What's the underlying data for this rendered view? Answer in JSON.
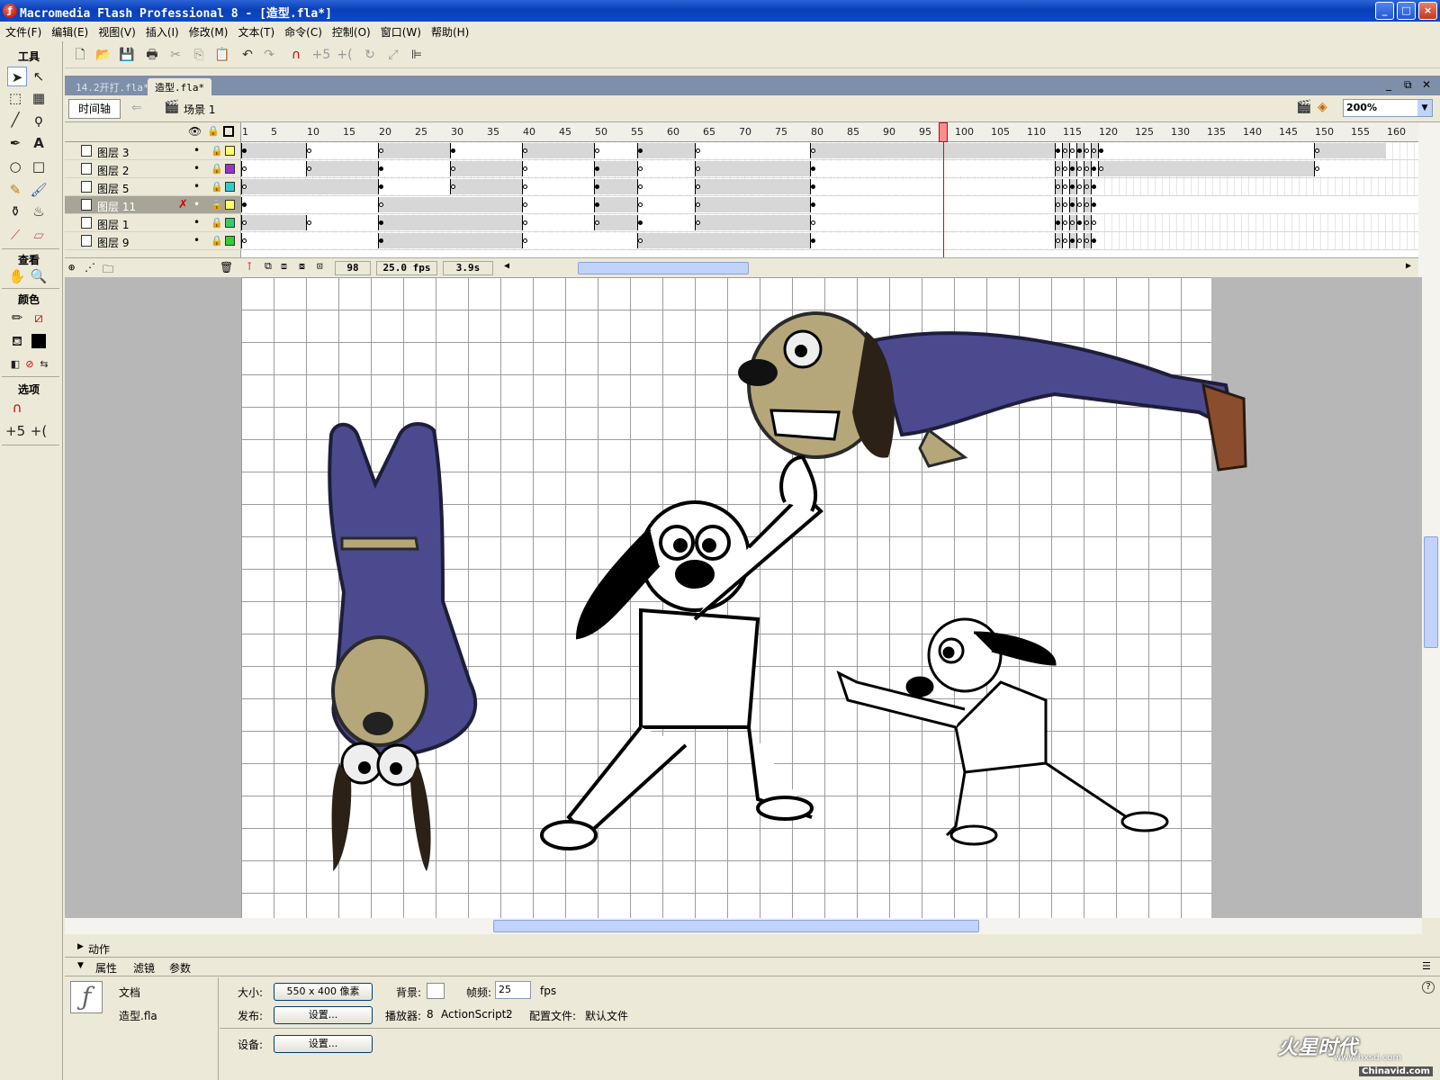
{
  "window": {
    "title": "Macromedia Flash Professional 8 - [造型.fla*]",
    "controls": [
      "_",
      "□",
      "×"
    ]
  },
  "menu": [
    "文件(F)",
    "编辑(E)",
    "视图(V)",
    "插入(I)",
    "修改(M)",
    "文本(T)",
    "命令(C)",
    "控制(O)",
    "窗口(W)",
    "帮助(H)"
  ],
  "tools": {
    "header_tools": "工具",
    "header_view": "查看",
    "header_colors": "颜色",
    "header_options": "选项"
  },
  "doc_tabs": [
    {
      "label": "14.2开打.fla*",
      "active": false
    },
    {
      "label": "造型.fla*",
      "active": true
    }
  ],
  "timeline": {
    "button_label": "时间轴",
    "scene": "场景 1",
    "zoom": "200%",
    "ruler_labels": [
      "1",
      "5",
      "10",
      "15",
      "20",
      "25",
      "30",
      "35",
      "40",
      "45",
      "50",
      "55",
      "60",
      "65",
      "70",
      "75",
      "80",
      "85",
      "90",
      "95",
      "100",
      "105",
      "110",
      "115",
      "120",
      "125",
      "130",
      "135",
      "140",
      "145",
      "150",
      "155",
      "160"
    ],
    "current_frame": "98",
    "fps": "25.0 fps",
    "elapsed": "3.9s",
    "layers": [
      {
        "name": "图层 3",
        "color": "#ffff66",
        "selected": false
      },
      {
        "name": "图层 2",
        "color": "#9933cc",
        "selected": false
      },
      {
        "name": "图层 5",
        "color": "#33cccc",
        "selected": false
      },
      {
        "name": "图层 11",
        "color": "#ffff66",
        "selected": true
      },
      {
        "name": "图层 1",
        "color": "#33cc66",
        "selected": false
      },
      {
        "name": "图层 9",
        "color": "#33cc33",
        "selected": false
      }
    ]
  },
  "panels": {
    "actions": "动作",
    "tabs": [
      "属性",
      "滤镜",
      "参数"
    ]
  },
  "properties": {
    "doc_type": "文档",
    "file_name": "造型.fla",
    "size_label": "大小:",
    "size_value": "550 x 400 像素",
    "bg_label": "背景:",
    "fps_label": "帧频:",
    "fps_value": "25",
    "fps_unit": "fps",
    "publish_label": "发布:",
    "publish_button": "设置...",
    "player_label": "播放器:",
    "player_value": "8",
    "as_label": "ActionScript:",
    "as_value": "2",
    "profile_label": "配置文件:",
    "profile_value": "默认文件",
    "device_label": "设备:",
    "device_button": "设置..."
  },
  "watermark": {
    "logo": "火星时代",
    "url": "www.hxsd.com",
    "brand": "Chinavid.com"
  },
  "colors": {
    "title_blue": "#0a3fb8",
    "suit_purple": "#4b4a8f",
    "dog_skin": "#b5a77a",
    "playhead_red": "#e00000"
  }
}
